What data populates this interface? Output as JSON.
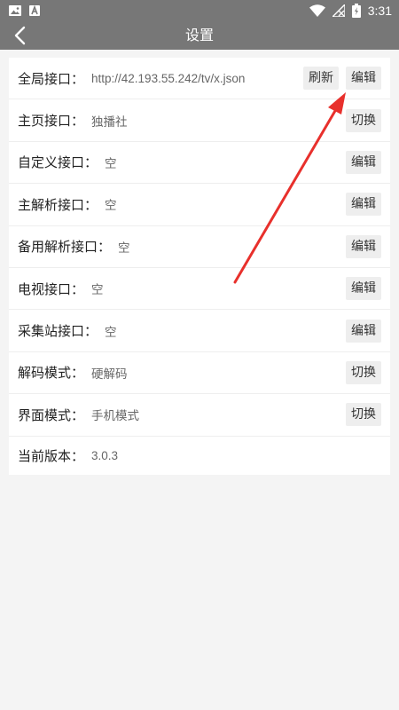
{
  "status_bar": {
    "time": "3:31",
    "icons": [
      "image-icon",
      "a-badge-icon",
      "wifi-icon",
      "signal-off-icon",
      "battery-charging-icon"
    ]
  },
  "toolbar": {
    "title": "设置",
    "back_icon": "chevron-left-icon"
  },
  "settings": {
    "rows": [
      {
        "label": "全局接口：",
        "value": "http://42.193.55.242/tv/x.json",
        "buttons": [
          "刷新",
          "编辑"
        ]
      },
      {
        "label": "主页接口：",
        "value": "独播社",
        "buttons": [
          "切换"
        ]
      },
      {
        "label": "自定义接口：",
        "value": "空",
        "buttons": [
          "编辑"
        ]
      },
      {
        "label": "主解析接口：",
        "value": "空",
        "buttons": [
          "编辑"
        ]
      },
      {
        "label": "备用解析接口：",
        "value": "空",
        "buttons": [
          "编辑"
        ]
      },
      {
        "label": "电视接口：",
        "value": "空",
        "buttons": [
          "编辑"
        ]
      },
      {
        "label": "采集站接口：",
        "value": "空",
        "buttons": [
          "编辑"
        ]
      },
      {
        "label": "解码模式：",
        "value": "硬解码",
        "buttons": [
          "切换"
        ]
      },
      {
        "label": "界面模式：",
        "value": "手机模式",
        "buttons": [
          "切换"
        ]
      },
      {
        "label": "当前版本：",
        "value": "3.0.3",
        "buttons": []
      }
    ]
  },
  "annotation": {
    "color": "#e8302c"
  }
}
